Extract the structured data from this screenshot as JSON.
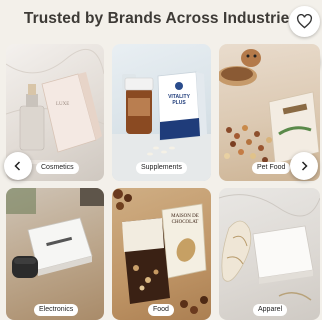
{
  "header": {
    "title": "Trusted by Brands Across Industries"
  },
  "actions": {
    "favorite_icon": "heart-icon",
    "visual_search_icon": "lens-search-icon"
  },
  "carousel": {
    "prev_icon": "chevron-left-icon",
    "next_icon": "chevron-right-icon",
    "tiles": [
      {
        "label": "Cosmetics",
        "box_text": "LUXE"
      },
      {
        "label": "Supplements",
        "box_text": "VITALITY PLUS"
      },
      {
        "label": "Pet Food",
        "box_text": ""
      },
      {
        "label": "Electronics",
        "box_text": ""
      },
      {
        "label": "Food",
        "box_text": "MAISON DE CHOCOLAT"
      },
      {
        "label": "Apparel",
        "box_text": ""
      }
    ]
  }
}
